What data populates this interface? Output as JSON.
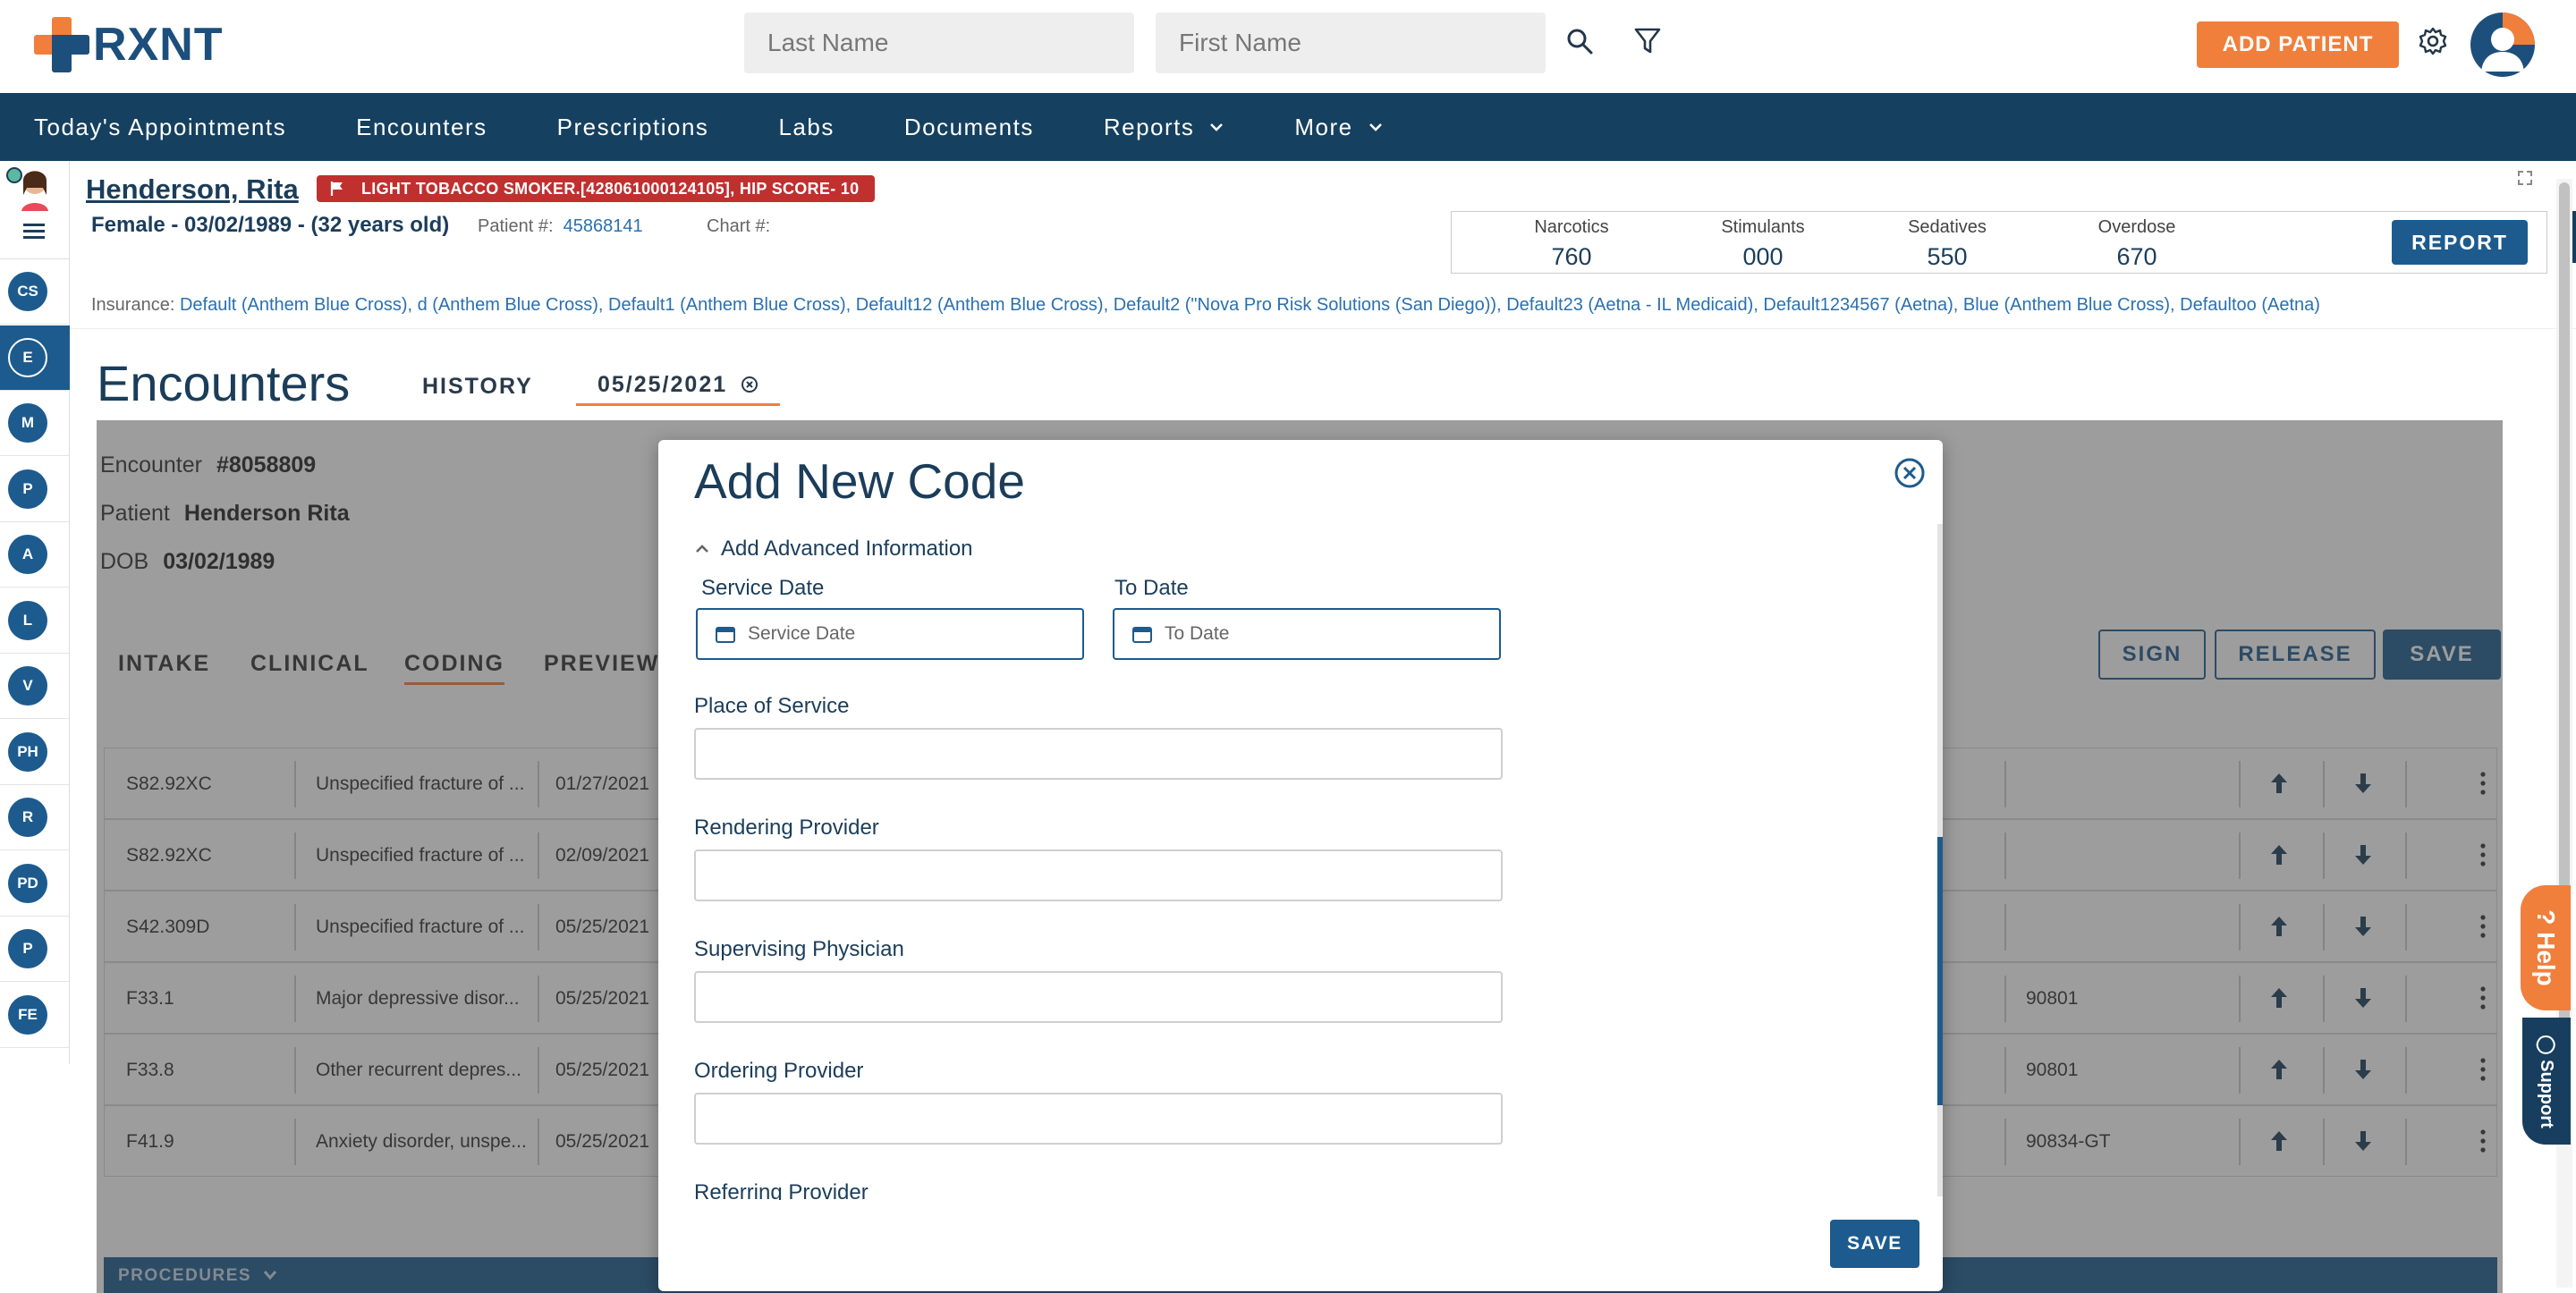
{
  "header": {
    "logo_text": "RXNT",
    "last_name_placeholder": "Last Name",
    "first_name_placeholder": "First Name",
    "add_patient_label": "ADD PATIENT"
  },
  "nav": {
    "items": [
      {
        "label": "Today's Appointments"
      },
      {
        "label": "Encounters"
      },
      {
        "label": "Prescriptions"
      },
      {
        "label": "Labs"
      },
      {
        "label": "Documents"
      },
      {
        "label": "Reports"
      },
      {
        "label": "More"
      }
    ]
  },
  "sidebar": {
    "items": [
      "CS",
      "E",
      "M",
      "P",
      "A",
      "L",
      "V",
      "PH",
      "R",
      "PD",
      "P",
      "FE"
    ],
    "active_index": 1
  },
  "patient": {
    "name": "Henderson, Rita",
    "flag": "LIGHT TOBACCO SMOKER.[428061000124105], HIP SCORE- 10",
    "demographics": "Female - 03/02/1989 - (32 years old)",
    "patient_num_label": "Patient #:",
    "patient_num": "45868141",
    "chart_label": "Chart #:",
    "insurance_label": "Insurance:",
    "insurance": "Default (Anthem Blue Cross), d (Anthem Blue Cross), Default1 (Anthem Blue Cross), Default12 (Anthem Blue Cross), Default2 (\"Nova Pro Risk Solutions (San Diego)), Default23 (Aetna - IL Medicaid), Default1234567 (Aetna), Blue (Anthem Blue Cross), Defaultoo (Aetna)"
  },
  "pdmp": {
    "narcotics_label": "Narcotics",
    "narcotics": "760",
    "stimulants_label": "Stimulants",
    "stimulants": "000",
    "sedatives_label": "Sedatives",
    "sedatives": "550",
    "overdose_label": "Overdose",
    "overdose": "670",
    "report_label": "REPORT"
  },
  "encounters": {
    "title": "Encounters",
    "tab_history": "HISTORY",
    "tab_date": "05/25/2021",
    "encounter_label": "Encounter",
    "encounter_num": "#8058809",
    "patient_label": "Patient",
    "patient_name": "Henderson Rita",
    "dob_label": "DOB",
    "dob": "03/02/1989",
    "sub_tabs": [
      "INTAKE",
      "CLINICAL",
      "CODING",
      "PREVIEW"
    ],
    "sign_label": "SIGN",
    "release_label": "RELEASE",
    "save_label": "SAVE",
    "procedures_label": "PROCEDURES",
    "rows": [
      {
        "code": "S82.92XC",
        "desc": "Unspecified fracture of ...",
        "date": "01/27/2021",
        "cpt": ""
      },
      {
        "code": "S82.92XC",
        "desc": "Unspecified fracture of ...",
        "date": "02/09/2021",
        "cpt": ""
      },
      {
        "code": "S42.309D",
        "desc": "Unspecified fracture of ...",
        "date": "05/25/2021",
        "cpt": ""
      },
      {
        "code": "F33.1",
        "desc": "Major depressive disor...",
        "date": "05/25/2021",
        "cpt": "90801"
      },
      {
        "code": "F33.8",
        "desc": "Other recurrent depres...",
        "date": "05/25/2021",
        "cpt": "90801"
      },
      {
        "code": "F41.9",
        "desc": "Anxiety disorder, unspe...",
        "date": "05/25/2021",
        "cpt": "90834-GT"
      }
    ]
  },
  "modal": {
    "title": "Add New Code",
    "advanced_toggle": "Add Advanced Information",
    "service_date_label": "Service Date",
    "service_date_placeholder": "Service Date",
    "to_date_label": "To Date",
    "to_date_placeholder": "To Date",
    "place_of_service_label": "Place of Service",
    "rendering_provider_label": "Rendering Provider",
    "supervising_physician_label": "Supervising Physician",
    "ordering_provider_label": "Ordering Provider",
    "referring_provider_label": "Referring Provider",
    "save_label": "SAVE"
  },
  "widgets": {
    "help_label": "Help",
    "support_label": "Support"
  },
  "colors": {
    "brand_navy": "#15405f",
    "brand_blue": "#1d5b8e",
    "brand_orange": "#f07f3c",
    "flag_red": "#c0302f"
  }
}
